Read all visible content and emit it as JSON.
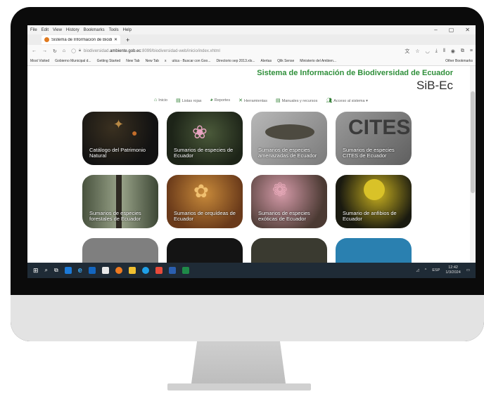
{
  "browser": {
    "menu": [
      "File",
      "Edit",
      "View",
      "History",
      "Bookmarks",
      "Tools",
      "Help"
    ],
    "tab_title": "Sistema de Información de Biodiversidad",
    "url_prefix": "biodiversidad.",
    "url_domain": "ambiente.gob.ec",
    "url_suffix": ":8099/biodiversidad-web/inicio/index.xhtml",
    "bookmarks": [
      "Most Visited",
      "Gobierno Municipal d...",
      "Getting Started",
      "New Tab",
      "New Tab",
      "x",
      "utica - Buscar con Goo...",
      "Directorio sep 2013.xls...",
      "Alertas",
      "Qlik Sense",
      "Ministerio del Ambien...",
      "Other Bookmarks"
    ]
  },
  "site": {
    "title": "Sistema de Información de Biodiversidad de Ecuador",
    "subtitle": "SiB-Ec",
    "nav": [
      "Inicio",
      "Listas rojas",
      "Reportes",
      "Herramientas",
      "Manuales y recursos",
      "Acceso al sistema"
    ]
  },
  "tiles": [
    "Catálogo del Patrimonio Natural",
    "Sumarios de especies de Ecuador",
    "Sumarios de especies amenazadas de Ecuador",
    "Sumarios de especies CITES de Ecuador",
    "Sumarios de especies forestales de Ecuador",
    "Sumarios de orquídeas de Ecuador",
    "Sumarios de especies exóticas de Ecuador",
    "Sumario de anfibios de Ecuador"
  ],
  "taskbar": {
    "lang": "ESP",
    "time": "12:42",
    "date": "1/3/2024"
  },
  "colors": {
    "title_green": "#2f8f3a",
    "taskbar": "#1f2b36",
    "monitor_bezel": "#0b0b0b"
  }
}
